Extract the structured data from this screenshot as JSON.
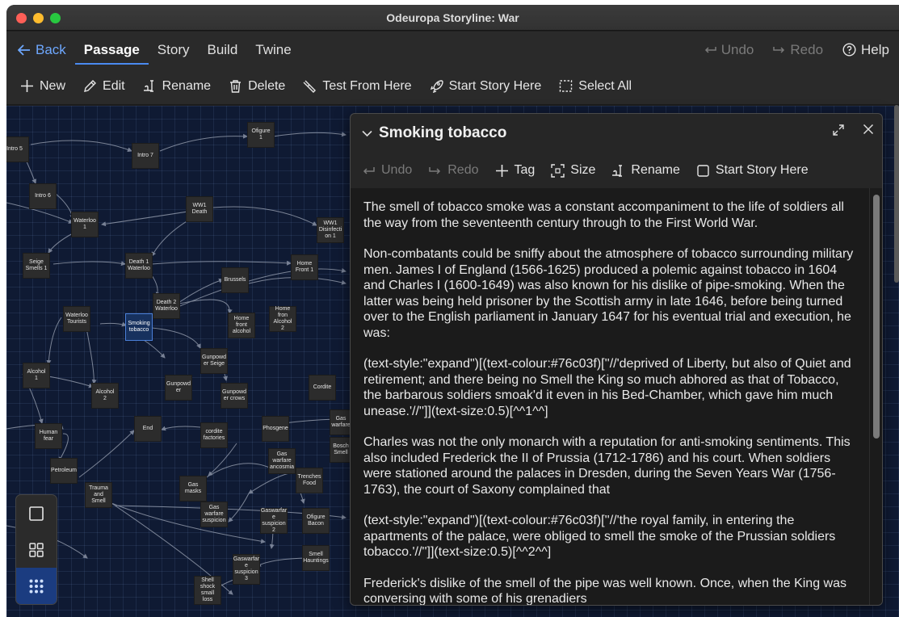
{
  "window": {
    "title": "Odeuropa Storyline: War"
  },
  "nav": {
    "back": "Back",
    "tabs": [
      "Passage",
      "Story",
      "Build",
      "Twine"
    ],
    "undo": "Undo",
    "redo": "Redo",
    "help": "Help"
  },
  "toolbar": {
    "new": "New",
    "edit": "Edit",
    "rename": "Rename",
    "delete": "Delete",
    "test_from_here": "Test From Here",
    "start_story_here": "Start Story Here",
    "select_all": "Select All"
  },
  "passages": [
    "Intro 5",
    "Intro 7",
    "Ofigure 1",
    "Intro 6",
    "WW1 Death",
    "Waterloo 1",
    "WW1 Disinfecti on 1",
    "Seige Smells 1",
    "Death 1 Waterloo",
    "Home Front 1",
    "Brussels",
    "Death 2 Waterloo",
    "Waterloo Tourists",
    "Smoking tobacco",
    "Home front alcohol",
    "Home fron Alcohol 2",
    "Gunpowd er Seige",
    "Alcohol 1",
    "Gunpowd er",
    "Alcohol 2",
    "Gunpowd er crows",
    "Cordite",
    "Human fear",
    "End",
    "cordite factories",
    "Phosgene",
    "Gas warfare",
    "Bosch Smell",
    "Petroleum",
    "Gas warfare ancosmia",
    "Trenches Food",
    "Gas masks",
    "Trauma and Smell",
    "Gas warfare suspicion",
    "Gaswarfar e suspicion 2",
    "Ofigure Bacon",
    "Smell Hauntings",
    "Gaswarfar e suspicion 3",
    "Shell shock small loss"
  ],
  "dialog": {
    "title": "Smoking tobacco",
    "undo": "Undo",
    "redo": "Redo",
    "tag": "Tag",
    "size": "Size",
    "rename": "Rename",
    "start_story_here": "Start Story Here",
    "paragraphs": [
      "The smell of tobacco smoke was a constant accompaniment to the life of soldiers all the way from the seventeenth century through to the First World War.",
      "Non-combatants could be sniffy about the atmosphere of tobacco surrounding military men. James I of England (1566-1625) produced a polemic against tobacco in 1604 and Charles I (1600-1649) was also known for his dislike of pipe-smoking. When the latter was being held prisoner by the Scottish army in late 1646, before being turned over to the English parliament in January 1647 for his eventual trial and execution, he was:",
      "(text-style:\"expand\")[(text-colour:#76c03f)[''//'deprived of Liberty, but also of Quiet and retirement; and there being no Smell the King so much abhored as that of Tobacco, the barbarous soldiers smoak'd it even in his Bed-Chamber, which gave him much unease.'//'']](text-size:0.5)[^^1^^]",
      "Charles was not the only monarch with a reputation for anti-smoking sentiments. This also included Frederick the II of Prussia (1712-1786) and his court. When soldiers were stationed around the palaces in Dresden, during the Seven Years War (1756-1763), the court  of Saxony complained that",
      "(text-style:\"expand\")[(text-colour:#76c03f)[''//'the royal family, in entering the apartments of the palace, were obliged to smell the smoke of the Prussian soldiers tobacco.'//'']](text-size:0.5)[^^2^^]",
      "Frederick's dislike of the smell of the pipe was well known. Once, when the King was conversing with some of his grenadiers"
    ]
  }
}
